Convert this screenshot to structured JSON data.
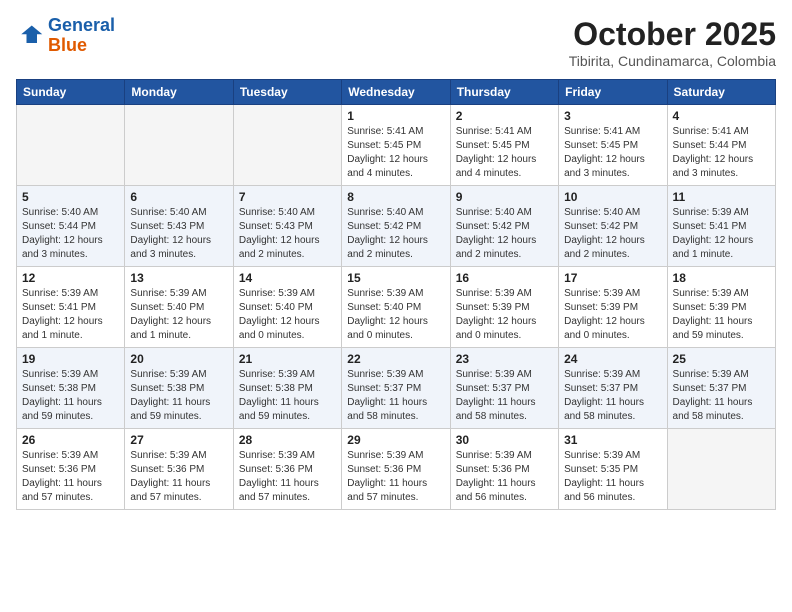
{
  "logo": {
    "line1": "General",
    "line2": "Blue"
  },
  "header": {
    "month": "October 2025",
    "location": "Tibirita, Cundinamarca, Colombia"
  },
  "weekdays": [
    "Sunday",
    "Monday",
    "Tuesday",
    "Wednesday",
    "Thursday",
    "Friday",
    "Saturday"
  ],
  "weeks": [
    [
      {
        "day": "",
        "info": ""
      },
      {
        "day": "",
        "info": ""
      },
      {
        "day": "",
        "info": ""
      },
      {
        "day": "1",
        "info": "Sunrise: 5:41 AM\nSunset: 5:45 PM\nDaylight: 12 hours\nand 4 minutes."
      },
      {
        "day": "2",
        "info": "Sunrise: 5:41 AM\nSunset: 5:45 PM\nDaylight: 12 hours\nand 4 minutes."
      },
      {
        "day": "3",
        "info": "Sunrise: 5:41 AM\nSunset: 5:45 PM\nDaylight: 12 hours\nand 3 minutes."
      },
      {
        "day": "4",
        "info": "Sunrise: 5:41 AM\nSunset: 5:44 PM\nDaylight: 12 hours\nand 3 minutes."
      }
    ],
    [
      {
        "day": "5",
        "info": "Sunrise: 5:40 AM\nSunset: 5:44 PM\nDaylight: 12 hours\nand 3 minutes."
      },
      {
        "day": "6",
        "info": "Sunrise: 5:40 AM\nSunset: 5:43 PM\nDaylight: 12 hours\nand 3 minutes."
      },
      {
        "day": "7",
        "info": "Sunrise: 5:40 AM\nSunset: 5:43 PM\nDaylight: 12 hours\nand 2 minutes."
      },
      {
        "day": "8",
        "info": "Sunrise: 5:40 AM\nSunset: 5:42 PM\nDaylight: 12 hours\nand 2 minutes."
      },
      {
        "day": "9",
        "info": "Sunrise: 5:40 AM\nSunset: 5:42 PM\nDaylight: 12 hours\nand 2 minutes."
      },
      {
        "day": "10",
        "info": "Sunrise: 5:40 AM\nSunset: 5:42 PM\nDaylight: 12 hours\nand 2 minutes."
      },
      {
        "day": "11",
        "info": "Sunrise: 5:39 AM\nSunset: 5:41 PM\nDaylight: 12 hours\nand 1 minute."
      }
    ],
    [
      {
        "day": "12",
        "info": "Sunrise: 5:39 AM\nSunset: 5:41 PM\nDaylight: 12 hours\nand 1 minute."
      },
      {
        "day": "13",
        "info": "Sunrise: 5:39 AM\nSunset: 5:40 PM\nDaylight: 12 hours\nand 1 minute."
      },
      {
        "day": "14",
        "info": "Sunrise: 5:39 AM\nSunset: 5:40 PM\nDaylight: 12 hours\nand 0 minutes."
      },
      {
        "day": "15",
        "info": "Sunrise: 5:39 AM\nSunset: 5:40 PM\nDaylight: 12 hours\nand 0 minutes."
      },
      {
        "day": "16",
        "info": "Sunrise: 5:39 AM\nSunset: 5:39 PM\nDaylight: 12 hours\nand 0 minutes."
      },
      {
        "day": "17",
        "info": "Sunrise: 5:39 AM\nSunset: 5:39 PM\nDaylight: 12 hours\nand 0 minutes."
      },
      {
        "day": "18",
        "info": "Sunrise: 5:39 AM\nSunset: 5:39 PM\nDaylight: 11 hours\nand 59 minutes."
      }
    ],
    [
      {
        "day": "19",
        "info": "Sunrise: 5:39 AM\nSunset: 5:38 PM\nDaylight: 11 hours\nand 59 minutes."
      },
      {
        "day": "20",
        "info": "Sunrise: 5:39 AM\nSunset: 5:38 PM\nDaylight: 11 hours\nand 59 minutes."
      },
      {
        "day": "21",
        "info": "Sunrise: 5:39 AM\nSunset: 5:38 PM\nDaylight: 11 hours\nand 59 minutes."
      },
      {
        "day": "22",
        "info": "Sunrise: 5:39 AM\nSunset: 5:37 PM\nDaylight: 11 hours\nand 58 minutes."
      },
      {
        "day": "23",
        "info": "Sunrise: 5:39 AM\nSunset: 5:37 PM\nDaylight: 11 hours\nand 58 minutes."
      },
      {
        "day": "24",
        "info": "Sunrise: 5:39 AM\nSunset: 5:37 PM\nDaylight: 11 hours\nand 58 minutes."
      },
      {
        "day": "25",
        "info": "Sunrise: 5:39 AM\nSunset: 5:37 PM\nDaylight: 11 hours\nand 58 minutes."
      }
    ],
    [
      {
        "day": "26",
        "info": "Sunrise: 5:39 AM\nSunset: 5:36 PM\nDaylight: 11 hours\nand 57 minutes."
      },
      {
        "day": "27",
        "info": "Sunrise: 5:39 AM\nSunset: 5:36 PM\nDaylight: 11 hours\nand 57 minutes."
      },
      {
        "day": "28",
        "info": "Sunrise: 5:39 AM\nSunset: 5:36 PM\nDaylight: 11 hours\nand 57 minutes."
      },
      {
        "day": "29",
        "info": "Sunrise: 5:39 AM\nSunset: 5:36 PM\nDaylight: 11 hours\nand 57 minutes."
      },
      {
        "day": "30",
        "info": "Sunrise: 5:39 AM\nSunset: 5:36 PM\nDaylight: 11 hours\nand 56 minutes."
      },
      {
        "day": "31",
        "info": "Sunrise: 5:39 AM\nSunset: 5:35 PM\nDaylight: 11 hours\nand 56 minutes."
      },
      {
        "day": "",
        "info": ""
      }
    ]
  ]
}
